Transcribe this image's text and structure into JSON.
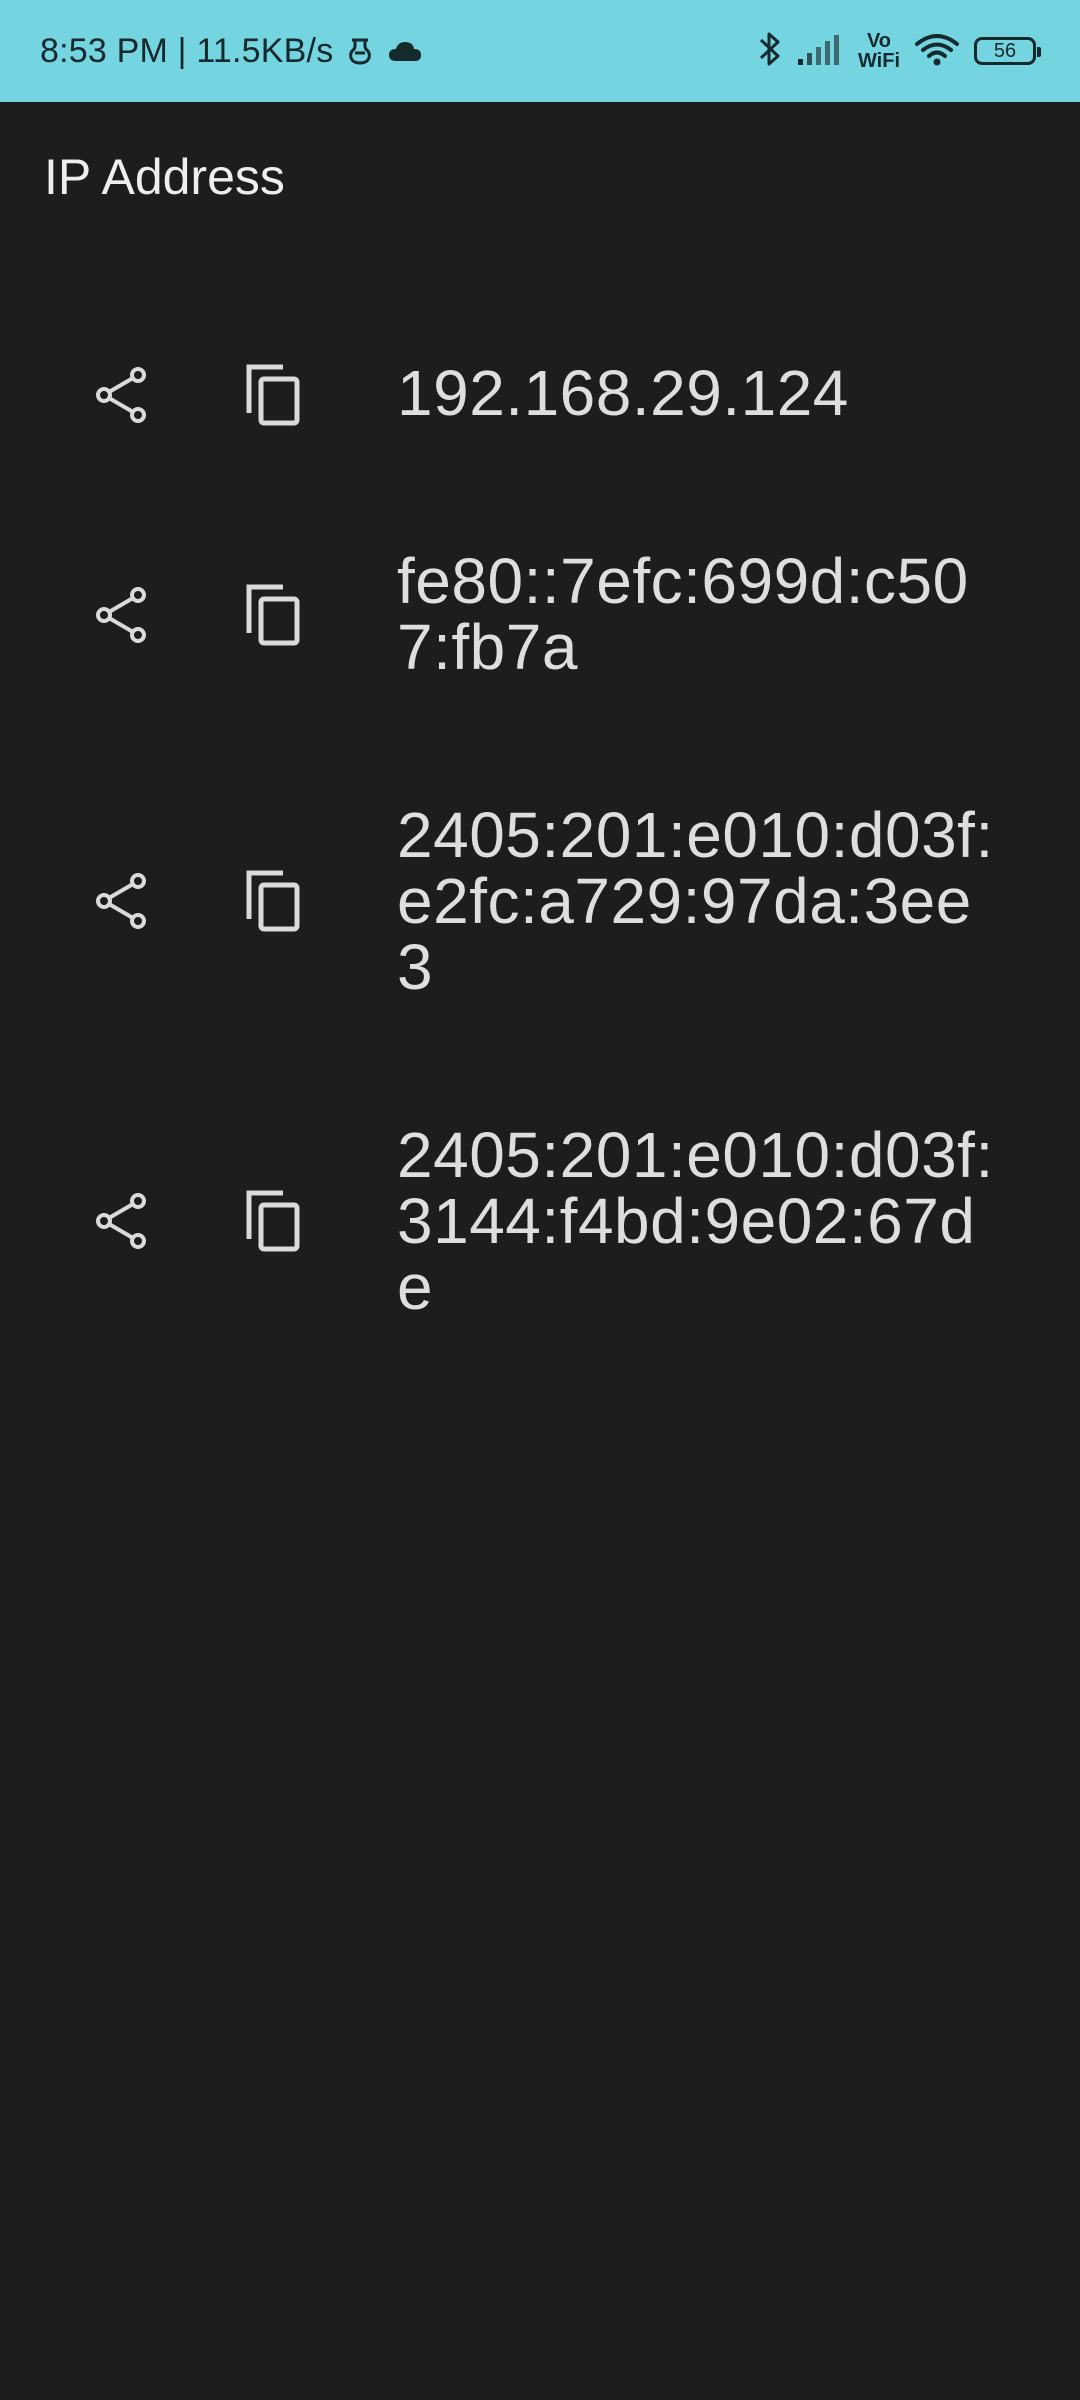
{
  "status_bar": {
    "time_speed": "8:53 PM | 11.5KB/s",
    "vowifi_top": "Vo",
    "vowifi_bottom": "WiFi",
    "battery": "56",
    "icons": [
      "notification-icon",
      "cloud-icon",
      "bluetooth-icon",
      "signal-icon",
      "vowifi-icon",
      "wifi-icon",
      "battery-icon"
    ]
  },
  "app": {
    "title": "IP Address"
  },
  "addresses": [
    {
      "value": "192.168.29.124"
    },
    {
      "value": "fe80::7efc:699d:c507:fb7a"
    },
    {
      "value": "2405:201:e010:d03f:e2fc:a729:97da:3ee3"
    },
    {
      "value": "2405:201:e010:d03f:3144:f4bd:9e02:67de"
    }
  ],
  "colors": {
    "status_bar_bg": "#74d4e0",
    "background": "#1b1d1e",
    "text": "#dcdedf",
    "icon": "#d8dadb"
  }
}
